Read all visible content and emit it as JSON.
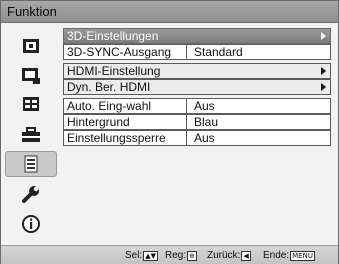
{
  "title": "Funktion",
  "sidebar": {
    "items": [
      {
        "icon": "picture-icon"
      },
      {
        "icon": "screen-icon"
      },
      {
        "icon": "setup-icon"
      },
      {
        "icon": "installation-icon"
      },
      {
        "icon": "function-icon",
        "active": true
      },
      {
        "icon": "wrench-icon"
      },
      {
        "icon": "info-icon"
      }
    ]
  },
  "menu": {
    "rows": [
      {
        "label": "3D-Einstellungen",
        "value": "",
        "submenu": true,
        "selected": true
      },
      {
        "label": "3D-SYNC-Ausgang",
        "value": "Standard",
        "submenu": false
      },
      {
        "label": "HDMI-Einstellung",
        "value": "",
        "submenu": true
      },
      {
        "label": "Dyn. Ber. HDMI",
        "value": "",
        "submenu": true
      },
      {
        "label": "Auto. Eing-wahl",
        "value": "Aus",
        "submenu": false
      },
      {
        "label": "Hintergrund",
        "value": "Blau",
        "submenu": false
      },
      {
        "label": "Einstellungssperre",
        "value": "Aus",
        "submenu": false
      }
    ]
  },
  "footer": {
    "sel_label": "Sel:",
    "sel_keys": "▲▼",
    "reg_label": "Reg:",
    "reg_key": "⊕",
    "back_label": "Zurück:",
    "back_key": "◀",
    "end_label": "Ende:",
    "end_key": "MENU"
  }
}
